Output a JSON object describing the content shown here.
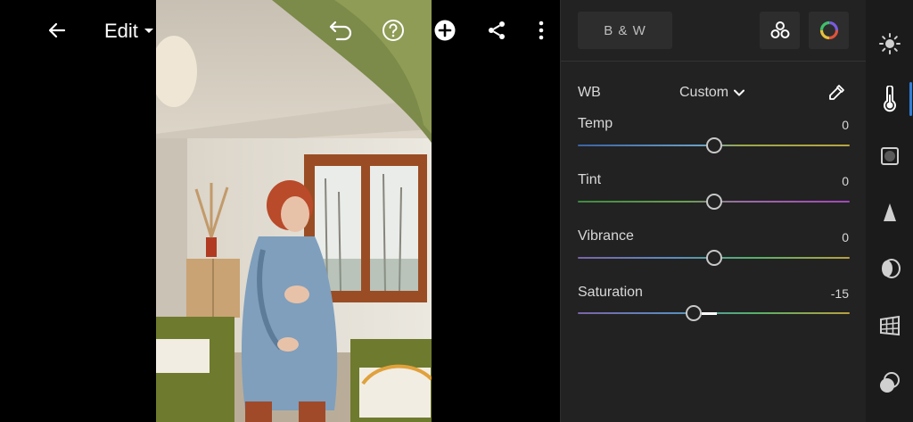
{
  "topbar": {
    "mode_label": "Edit"
  },
  "panel": {
    "bw_label": "B & W",
    "wb": {
      "label": "WB",
      "value": "Custom"
    },
    "sliders": [
      {
        "key": "temp",
        "label": "Temp",
        "value": "0",
        "position": 0.5
      },
      {
        "key": "tint",
        "label": "Tint",
        "value": "0",
        "position": 0.5
      },
      {
        "key": "vibrance",
        "label": "Vibrance",
        "value": "0",
        "position": 0.5
      },
      {
        "key": "saturation",
        "label": "Saturation",
        "value": "-15",
        "position": 0.425
      }
    ]
  },
  "toolbar": {
    "items": [
      "light-icon",
      "color-icon",
      "effects-icon",
      "detail-icon",
      "optics-icon",
      "geometry-icon",
      "presets-icon"
    ],
    "active": "color-icon"
  },
  "colors": {
    "accent": "#2f7dd9",
    "panel_bg": "#222222",
    "toolbar_bg": "#1b1b1b"
  }
}
